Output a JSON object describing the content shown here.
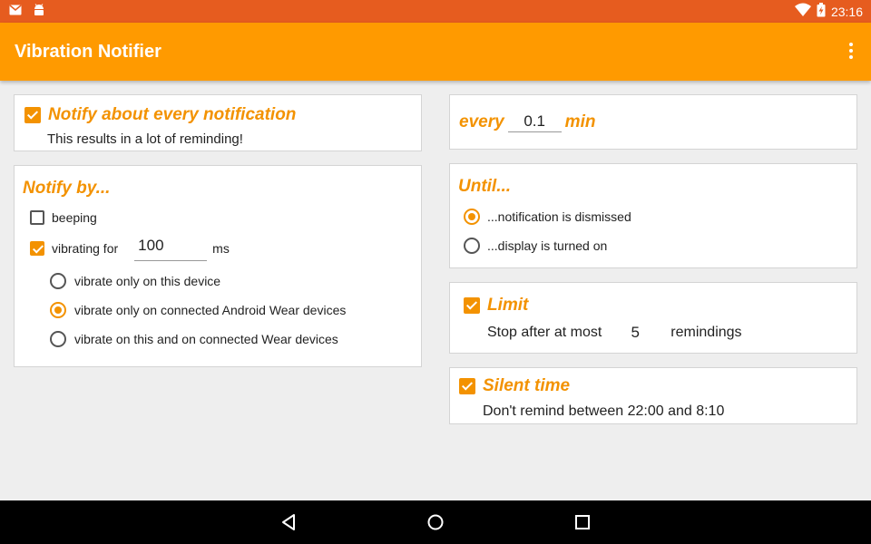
{
  "status_bar": {
    "time": "23:16",
    "icons": [
      "gmail-icon",
      "android-debug-icon",
      "wifi-icon",
      "battery-charging-icon"
    ]
  },
  "app_bar": {
    "title": "Vibration Notifier",
    "overflow_icon": "more-vert-icon"
  },
  "colors": {
    "status_bar": "#e65c1f",
    "app_bar": "#ff9a00",
    "accent": "#f39200"
  },
  "notify_every": {
    "checked": true,
    "title": "Notify about every notification",
    "subtitle": "This results in a lot of reminding!"
  },
  "interval": {
    "prefix": "every",
    "value": "0.1",
    "suffix": "min"
  },
  "notify_by": {
    "title": "Notify by...",
    "beeping": {
      "label": "beeping",
      "checked": false
    },
    "vibrating": {
      "label": "vibrating for",
      "value": "100",
      "unit": "ms",
      "checked": true
    },
    "options": [
      {
        "label": "vibrate only on this device",
        "selected": false
      },
      {
        "label": "vibrate only on connected Android Wear devices",
        "selected": true
      },
      {
        "label": "vibrate on this and on connected Wear devices",
        "selected": false
      }
    ]
  },
  "until": {
    "title": "Until...",
    "options": [
      {
        "label": "...notification is dismissed",
        "selected": true
      },
      {
        "label": "...display is turned on",
        "selected": false
      }
    ]
  },
  "limit": {
    "checked": true,
    "title": "Limit",
    "prefix": "Stop after at most",
    "value": "5",
    "suffix": "remindings"
  },
  "silent_time": {
    "checked": true,
    "title": "Silent time",
    "text": "Don't remind between 22:00 and 8:10"
  },
  "nav_bar": {
    "icons": [
      "back-icon",
      "home-icon",
      "recents-icon"
    ]
  }
}
